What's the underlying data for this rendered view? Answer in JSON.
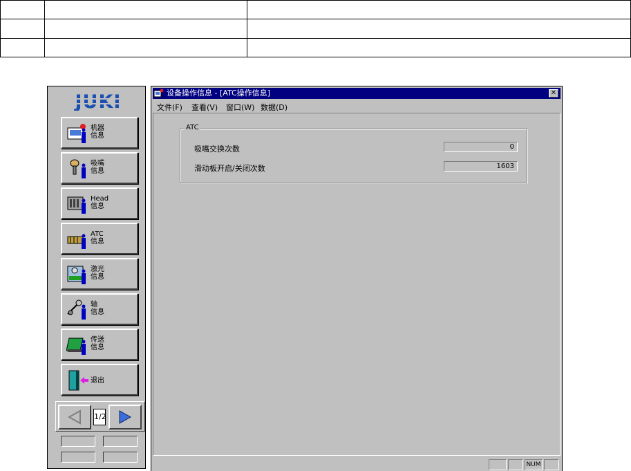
{
  "window": {
    "title": "设备操作信息 - [ATC操作信息]",
    "close_label": "✕"
  },
  "menu": [
    "文件(F)",
    "查看(V)",
    "窗口(W)",
    "数据(D)"
  ],
  "sidebar": {
    "logo": "JUKI",
    "buttons": [
      {
        "label": "机器\n信息",
        "icon": "machine-info-icon"
      },
      {
        "label": "吸嘴\n信息",
        "icon": "nozzle-info-icon"
      },
      {
        "label": "Head\n信息",
        "icon": "head-info-icon"
      },
      {
        "label": "ATC\n信息",
        "icon": "atc-info-icon"
      },
      {
        "label": "激光\n信息",
        "icon": "laser-info-icon"
      },
      {
        "label": "轴\n信息",
        "icon": "axis-info-icon"
      },
      {
        "label": "传送\n信息",
        "icon": "conveyor-info-icon"
      },
      {
        "label": "退出",
        "icon": "exit-door-icon"
      }
    ],
    "pager": {
      "page": "1/2",
      "prev_icon": "left-arrow-icon",
      "next_icon": "right-arrow-icon"
    }
  },
  "atc_group": {
    "legend": "ATC",
    "rows": [
      {
        "label": "吸嘴交换次数",
        "value": "0"
      },
      {
        "label": "滑动板开启/关闭次数",
        "value": "1603"
      }
    ]
  },
  "statusbar": {
    "num": "NUM"
  },
  "colors": {
    "titlebar": "#000080",
    "face": "#c0c0c0",
    "logo": "#1a4fb0"
  }
}
